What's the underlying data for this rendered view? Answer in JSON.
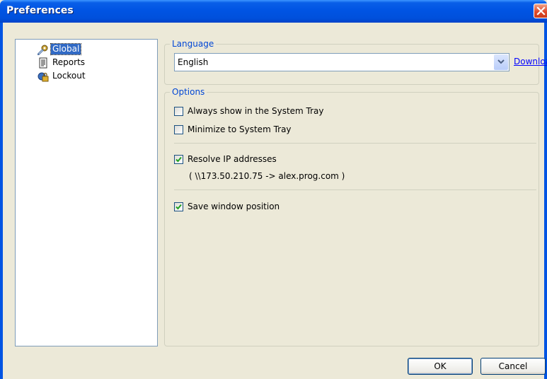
{
  "window": {
    "title": "Preferences"
  },
  "tree": {
    "items": [
      {
        "label": "Global",
        "icon": "wrench-gear-icon",
        "selected": true
      },
      {
        "label": "Reports",
        "icon": "report-document-icon",
        "selected": false
      },
      {
        "label": "Lockout",
        "icon": "lock-icon",
        "selected": false
      }
    ]
  },
  "language": {
    "legend": "Language",
    "selected": "English",
    "download_label": "Download"
  },
  "options": {
    "legend": "Options",
    "always_show_tray": {
      "label": "Always show in the System Tray",
      "checked": false
    },
    "minimize_tray": {
      "label": "Minimize to System Tray",
      "checked": false
    },
    "resolve_ip": {
      "label": "Resolve IP addresses",
      "checked": true
    },
    "resolve_example": "( \\\\173.50.210.75 -> alex.prog.com )",
    "save_position": {
      "label": "Save window position",
      "checked": true
    }
  },
  "buttons": {
    "ok": "OK",
    "cancel": "Cancel"
  },
  "colors": {
    "title_bar": "#0054e3",
    "selection": "#316ac5",
    "legend_text": "#0046d5",
    "link": "#0000ff"
  }
}
